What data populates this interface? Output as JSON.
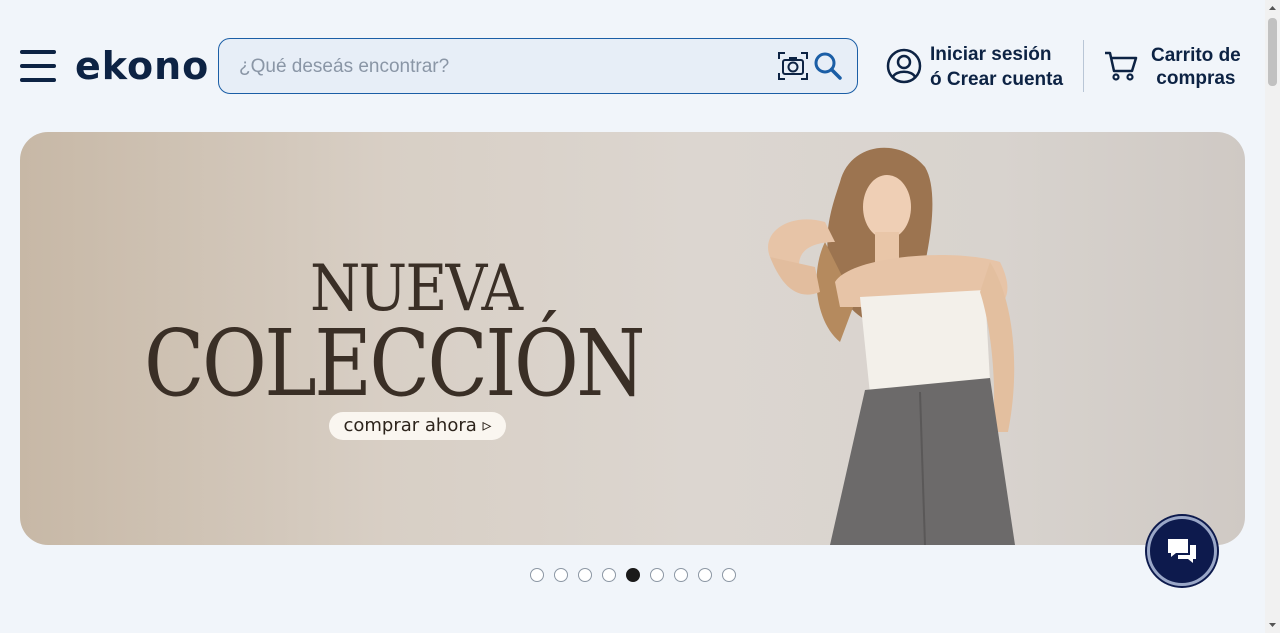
{
  "header": {
    "logo": "ekono",
    "search_placeholder": "¿Qué deseás encontrar?",
    "login_line1": "Iniciar sesión",
    "login_line2": "ó Crear cuenta",
    "cart_line1": "Carrito de",
    "cart_line2": "compras"
  },
  "banner": {
    "title_line1": "NUEVA",
    "title_line2": "COLECCIÓN",
    "cta": "comprar ahora"
  },
  "carousel": {
    "slide_count": 9,
    "active_index": 4
  },
  "colors": {
    "brand": "#0d2344",
    "accent": "#1b5ea6",
    "chat_bg": "#0d1a4d"
  },
  "icons": [
    "menu-icon",
    "camera-icon",
    "search-icon",
    "user-icon",
    "cart-icon",
    "chat-icon"
  ]
}
